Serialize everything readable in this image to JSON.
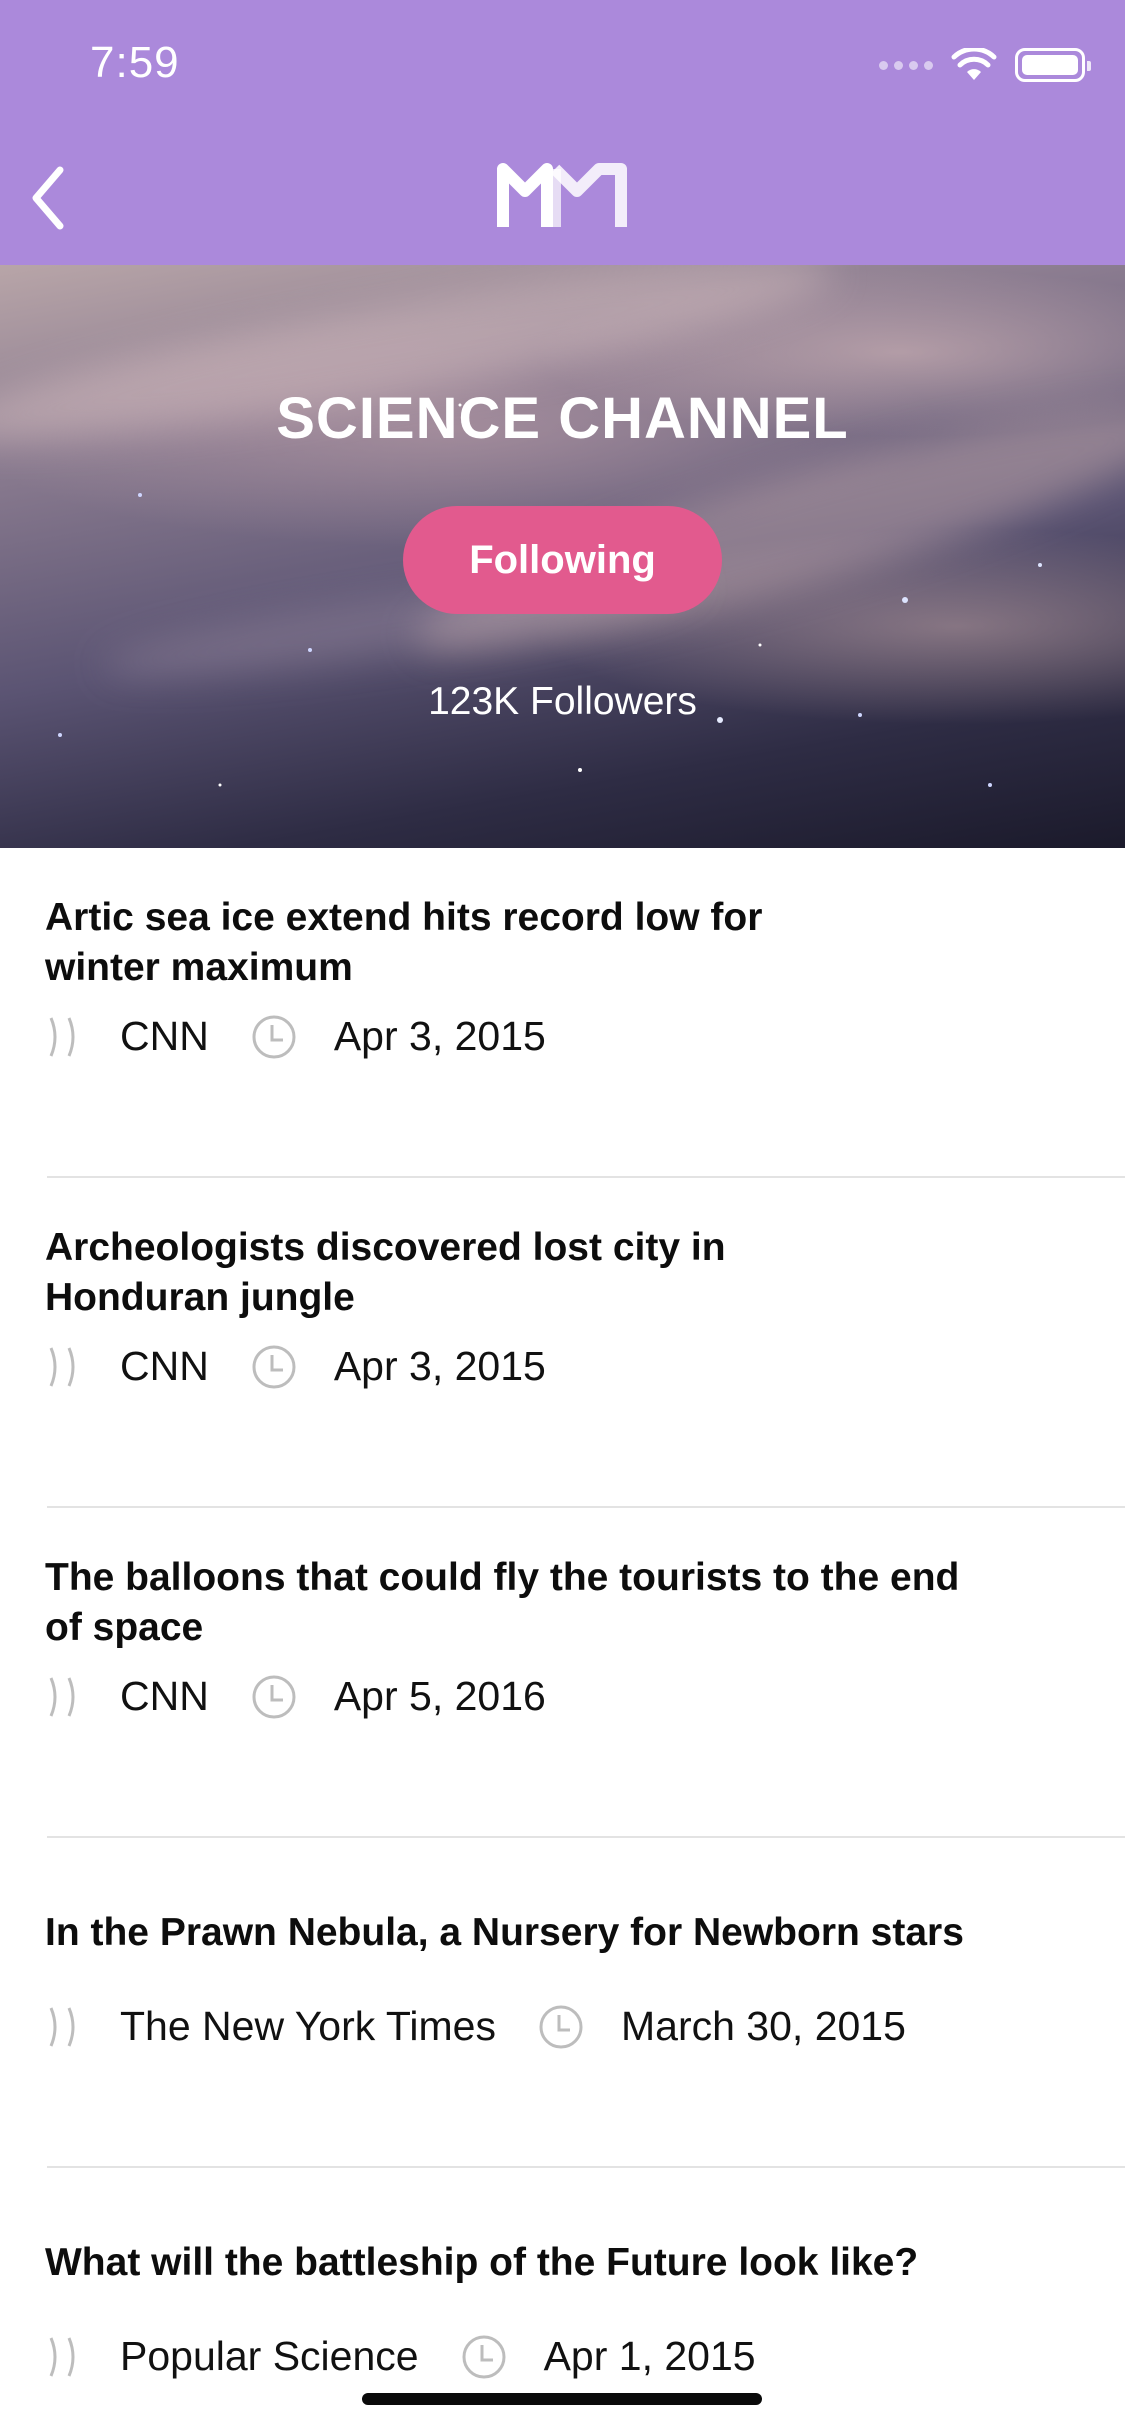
{
  "status_bar": {
    "time": "7:59"
  },
  "nav": {
    "logo_text": "MM"
  },
  "channel": {
    "title": "SCIENCE CHANNEL",
    "follow_label": "Following",
    "followers": "123K Followers"
  },
  "articles": [
    {
      "title": "Artic sea ice extend hits record low for\nwinter maximum",
      "source": "CNN",
      "date": "Apr 3, 2015"
    },
    {
      "title": "Archeologists discovered lost city in\nHonduran jungle",
      "source": "CNN",
      "date": "Apr 3, 2015"
    },
    {
      "title": "The balloons that could fly the tourists to the end\nof space",
      "source": "CNN",
      "date": "Apr 5, 2016"
    },
    {
      "title": "In the Prawn Nebula, a Nursery for Newborn stars",
      "source": "The New York Times",
      "date": "March 30, 2015"
    },
    {
      "title": "What will the battleship of the Future look like?",
      "source": "Popular Science",
      "date": "Apr 1, 2015"
    }
  ],
  "colors": {
    "nav_bar": "#ab89db",
    "follow_button": "#e25a8e",
    "divider": "#e3e3e3"
  }
}
